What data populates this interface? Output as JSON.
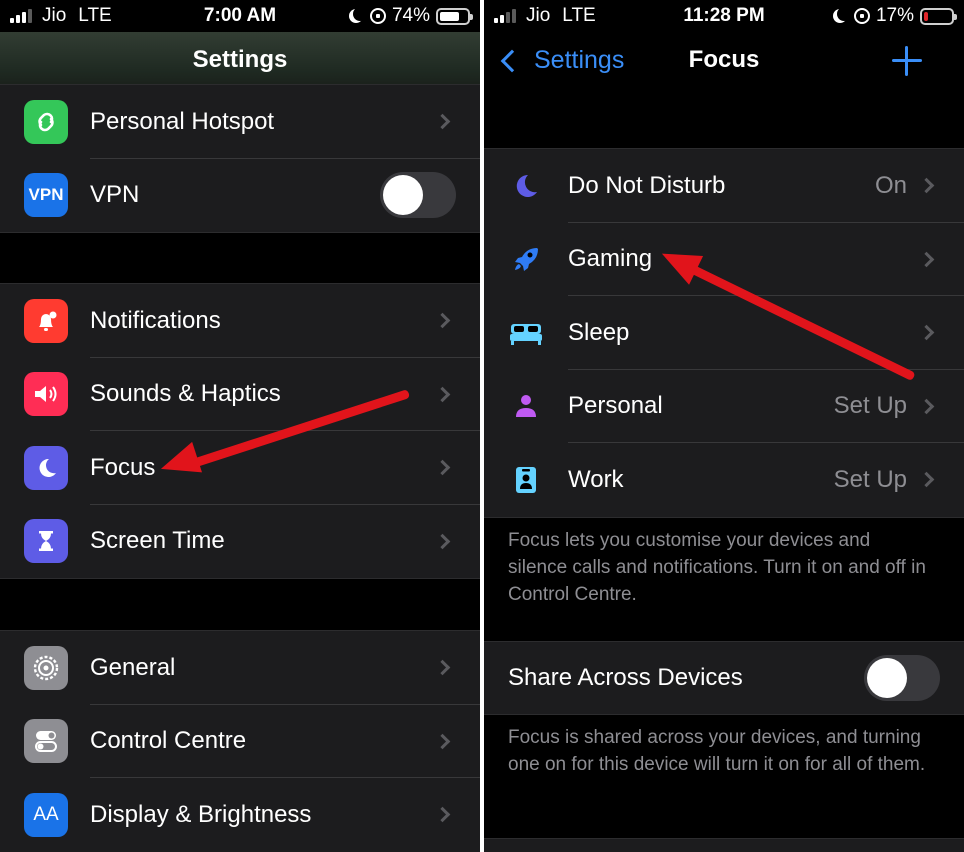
{
  "left": {
    "status": {
      "carrier": "Jio",
      "network": "LTE",
      "time": "7:00 AM",
      "battery": "74%",
      "battery_fraction": 0.74
    },
    "nav_title": "Settings",
    "group1": [
      {
        "label": "Personal Hotspot",
        "icon": "hotspot-icon"
      },
      {
        "label": "VPN",
        "icon": "vpn-icon",
        "icon_text": "VPN",
        "toggle": false
      }
    ],
    "group2": [
      {
        "label": "Notifications",
        "icon": "bell-icon"
      },
      {
        "label": "Sounds & Haptics",
        "icon": "speaker-icon"
      },
      {
        "label": "Focus",
        "icon": "moon-icon"
      },
      {
        "label": "Screen Time",
        "icon": "hourglass-icon"
      }
    ],
    "group3": [
      {
        "label": "General",
        "icon": "gear-icon"
      },
      {
        "label": "Control Centre",
        "icon": "switches-icon"
      },
      {
        "label": "Display & Brightness",
        "icon": "display-icon",
        "icon_text": "AA"
      }
    ]
  },
  "right": {
    "status": {
      "carrier": "Jio",
      "network": "LTE",
      "time": "11:28 PM",
      "battery": "17%",
      "battery_fraction": 0.17
    },
    "back_label": "Settings",
    "nav_title": "Focus",
    "focus_items": [
      {
        "label": "Do Not Disturb",
        "value": "On",
        "icon": "moon-icon",
        "color": "#5e5ce6"
      },
      {
        "label": "Gaming",
        "value": "",
        "icon": "rocket-icon",
        "color": "#2f7cf6"
      },
      {
        "label": "Sleep",
        "value": "",
        "icon": "bed-icon",
        "color": "#64d2ff"
      },
      {
        "label": "Personal",
        "value": "Set Up",
        "icon": "person-icon",
        "color": "#bf5af2"
      },
      {
        "label": "Work",
        "value": "Set Up",
        "icon": "badge-icon",
        "color": "#64d2ff"
      }
    ],
    "focus_footer": "Focus lets you customise your devices and silence calls and notifications. Turn it on and off in Control Centre.",
    "share_label": "Share Across Devices",
    "share_toggle": false,
    "share_footer": "Focus is shared across your devices, and turning one on for this device will turn it on for all of them."
  }
}
